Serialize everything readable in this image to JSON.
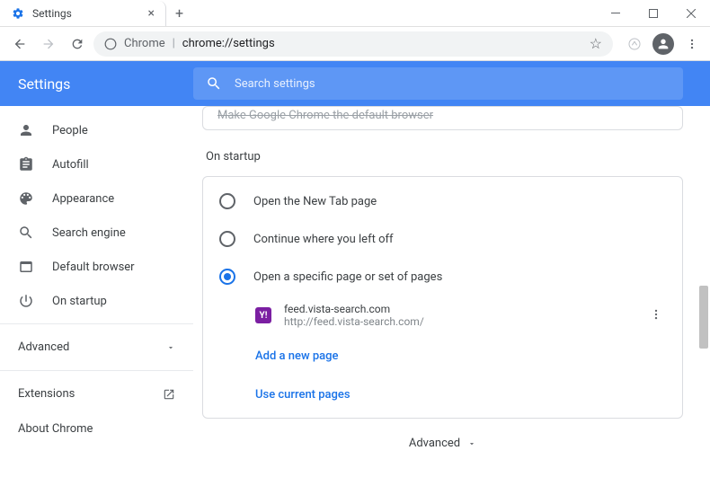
{
  "window": {
    "tab_title": "Settings",
    "url_origin": "Chrome",
    "url_path": "chrome://settings"
  },
  "header": {
    "title": "Settings",
    "search_placeholder": "Search settings"
  },
  "sidebar": {
    "items": [
      {
        "icon": "person",
        "label": "People"
      },
      {
        "icon": "autofill",
        "label": "Autofill"
      },
      {
        "icon": "palette",
        "label": "Appearance"
      },
      {
        "icon": "search",
        "label": "Search engine"
      },
      {
        "icon": "browser",
        "label": "Default browser"
      },
      {
        "icon": "power",
        "label": "On startup"
      }
    ],
    "advanced": "Advanced",
    "extensions": "Extensions",
    "about": "About Chrome"
  },
  "content": {
    "peek_text": "Make Google Chrome the default browser",
    "section_title": "On startup",
    "radios": [
      {
        "label": "Open the New Tab page",
        "checked": false
      },
      {
        "label": "Continue where you left off",
        "checked": false
      },
      {
        "label": "Open a specific page or set of pages",
        "checked": true
      }
    ],
    "page": {
      "title": "feed.vista-search.com",
      "url": "http://feed.vista-search.com/"
    },
    "add_page": "Add a new page",
    "use_current": "Use current pages",
    "bottom_advanced": "Advanced"
  }
}
